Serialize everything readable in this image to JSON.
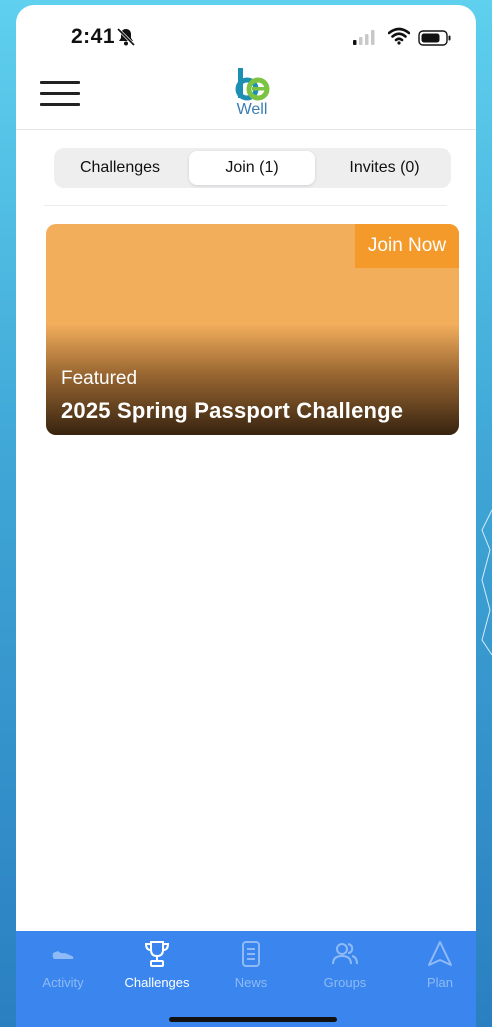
{
  "status_bar": {
    "time": "2:41",
    "icons": [
      "bell-slash-icon",
      "signal-icon",
      "wifi-icon",
      "battery-icon"
    ]
  },
  "header": {
    "logo_text": "Well",
    "icons": [
      "menu-icon"
    ]
  },
  "segments": {
    "items": [
      {
        "label": "Challenges",
        "active": false
      },
      {
        "label": "Join (1)",
        "active": true
      },
      {
        "label": "Invites (0)",
        "active": false
      }
    ]
  },
  "card": {
    "badge": "Join Now",
    "tag": "Featured",
    "title": "2025 Spring Passport Challenge",
    "background_color": "#f3ae5c",
    "badge_color": "#f39a2a"
  },
  "tab_bar": {
    "background_color": "#3a86ee",
    "items": [
      {
        "label": "Activity",
        "icon": "shoe-icon",
        "active": false
      },
      {
        "label": "Challenges",
        "icon": "trophy-icon",
        "active": true
      },
      {
        "label": "News",
        "icon": "document-icon",
        "active": false
      },
      {
        "label": "Groups",
        "icon": "people-icon",
        "active": false
      },
      {
        "label": "Plan",
        "icon": "navigation-arrow-icon",
        "active": false
      }
    ]
  }
}
